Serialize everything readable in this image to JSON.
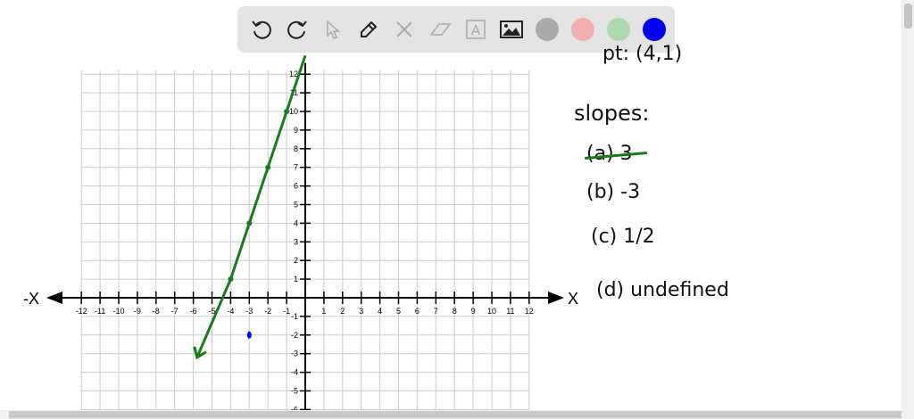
{
  "toolbar": {
    "tools": [
      "undo-icon",
      "redo-icon",
      "select-icon",
      "pen-icon",
      "tools-icon",
      "eraser-icon",
      "text-icon",
      "image-icon"
    ],
    "colors": [
      "#aaaaaa",
      "#f0b0b0",
      "#b0d8b0",
      "#0000ee"
    ]
  },
  "graph": {
    "x_neg_label": "-X",
    "x_pos_label": "X",
    "x_ticks": [
      -12,
      -11,
      -10,
      -9,
      -8,
      -7,
      -6,
      -5,
      -4,
      -3,
      -2,
      -1,
      1,
      2,
      3,
      4,
      5,
      6,
      7,
      8,
      9,
      10,
      11,
      12
    ],
    "y_ticks": [
      12,
      11,
      10,
      9,
      8,
      7,
      6,
      5,
      4,
      3,
      2,
      1,
      -1,
      -2,
      -3,
      -4,
      -5,
      -6
    ],
    "line_color": "#1a7a1a",
    "line_points": [
      [
        -5.8,
        -3.2
      ],
      [
        -4,
        1
      ],
      [
        -3,
        4
      ],
      [
        -2,
        7
      ],
      [
        -1,
        10
      ],
      [
        0,
        13
      ]
    ],
    "blue_point": [
      -3,
      -2
    ]
  },
  "notes": {
    "point": "pt: (4,1)",
    "slopes_title": "slopes:",
    "a": "(a) 3",
    "b": "(b) -3",
    "c": "(c) 1/2",
    "d": "(d) undefined"
  }
}
